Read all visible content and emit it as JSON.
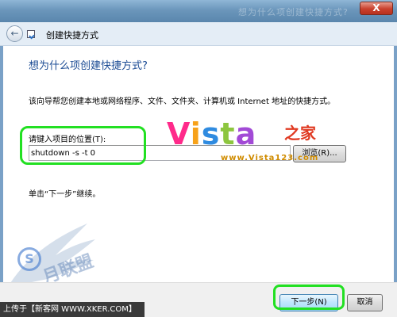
{
  "window": {
    "blurred_title": "想为什么项创建快捷方式?",
    "close_label": "X"
  },
  "nav": {
    "back_symbol": "←",
    "wizard_title": "创建快捷方式"
  },
  "content": {
    "heading": "想为什么项创建快捷方式?",
    "description": "该向导帮您创建本地或网络程序、文件、文件夹、计算机或 Internet 地址的快捷方式。",
    "location_label": "请键入项目的位置(T):",
    "location_value": "shutdown -s -t 0",
    "browse_label": "浏览(R)...",
    "hint": "单击“下一步”继续。"
  },
  "buttons": {
    "next_label": "下一步(N)",
    "cancel_label": "取消"
  },
  "watermarks": {
    "vista_v": "V",
    "vista_i": "i",
    "vista_s": "s",
    "vista_t": "t",
    "vista_a": "a",
    "vista_cn": "之家",
    "vista_url": "www.Vista123.com",
    "seal_letter": "S",
    "union_text": "月联盟",
    "upload_text": "上传于【新客网 WWW.XKER.COM】"
  },
  "colors": {
    "highlight": "#22e022",
    "heading": "#1b4b94",
    "titlebar": "#6b96bb"
  }
}
